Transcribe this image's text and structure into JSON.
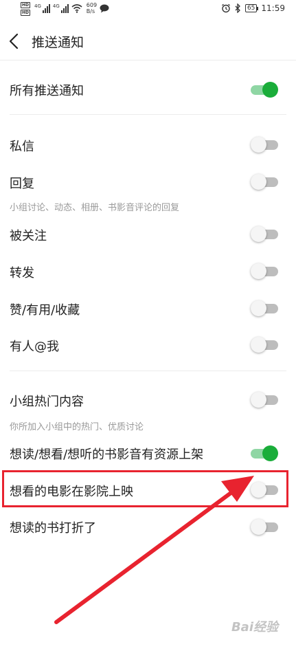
{
  "status_bar": {
    "hd": "HD",
    "net_a": "4G",
    "net_b": "4G",
    "speed_value": "609",
    "speed_unit": "B/s",
    "battery": "65",
    "time": "11:59"
  },
  "header": {
    "title": "推送通知"
  },
  "settings": {
    "all_push": {
      "label": "所有推送通知",
      "on": true
    },
    "private_msg": {
      "label": "私信",
      "on": false
    },
    "reply": {
      "label": "回复",
      "sub": "小组讨论、动态、相册、书影音评论的回复",
      "on": false
    },
    "followed": {
      "label": "被关注",
      "on": false
    },
    "repost": {
      "label": "转发",
      "on": false
    },
    "like": {
      "label": "赞/有用/收藏",
      "on": false
    },
    "mention": {
      "label": "有人@我",
      "on": false
    },
    "group_hot": {
      "label": "小组热门内容",
      "sub": "你所加入小组中的热门、优质讨论",
      "on": false
    },
    "wish_available": {
      "label": "想读/想看/想听的书影音有资源上架",
      "on": true
    },
    "movie_showing": {
      "label": "想看的电影在影院上映",
      "on": false
    },
    "book_discount": {
      "label": "想读的书打折了",
      "on": false
    }
  },
  "colors": {
    "accent_green": "#1aad3a",
    "highlight_red": "#e8232f"
  },
  "watermark": "Bai经验"
}
